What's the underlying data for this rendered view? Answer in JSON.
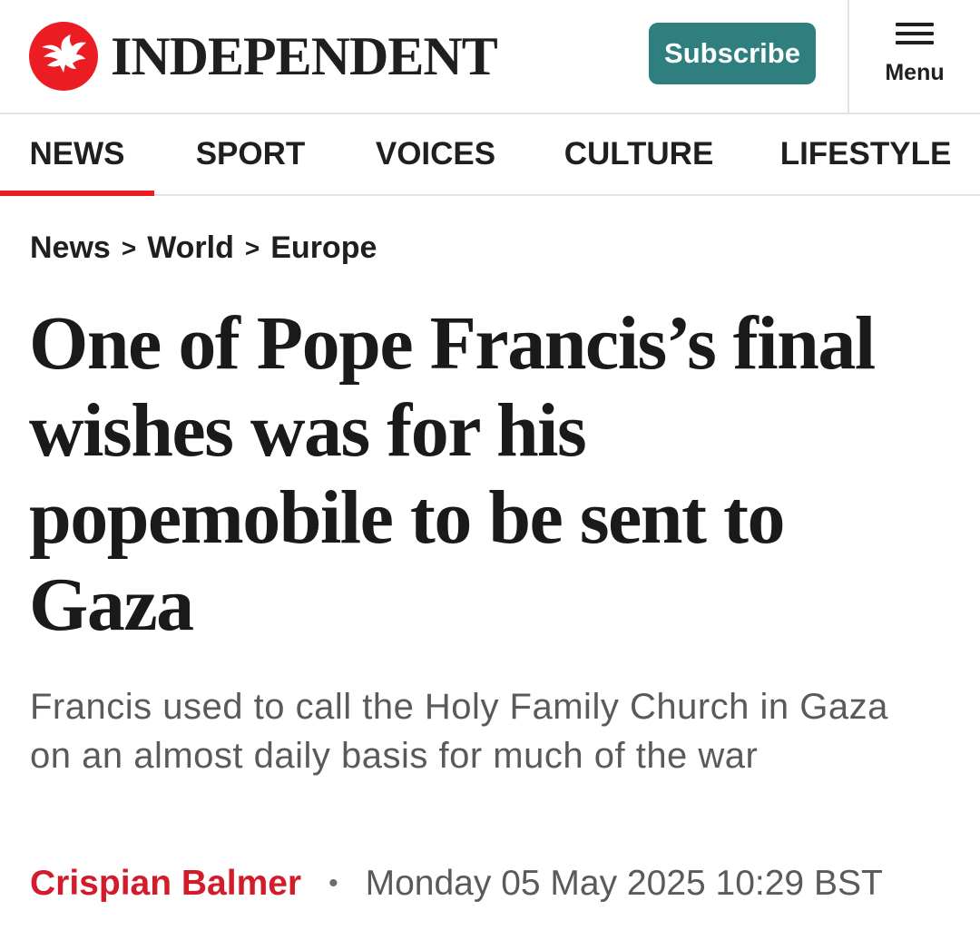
{
  "brand": {
    "name": "INDEPENDENT",
    "logo_icon": "eagle-icon",
    "logo_color": "#ec1c24"
  },
  "header": {
    "subscribe_label": "Subscribe",
    "subscribe_color": "#2f7f7e",
    "menu_label": "Menu",
    "menu_icon": "hamburger-icon"
  },
  "nav": {
    "active": "NEWS",
    "active_color": "#ec1c24",
    "items": [
      {
        "label": "NEWS"
      },
      {
        "label": "SPORT"
      },
      {
        "label": "VOICES"
      },
      {
        "label": "CULTURE"
      },
      {
        "label": "LIFESTYLE"
      }
    ]
  },
  "breadcrumb": {
    "items": [
      "News",
      "World",
      "Europe"
    ],
    "separator": ">"
  },
  "article": {
    "headline": "One of Pope Francis’s final wishes was for his popemobile to be sent to Gaza",
    "standfirst": "Francis used to call the Holy Family Church in Gaza on an almost daily basis for much of the war",
    "author": "Crispian Balmer",
    "author_color": "#d31c2b",
    "separator": "•",
    "published": "Monday 05 May 2025 10:29 BST"
  }
}
